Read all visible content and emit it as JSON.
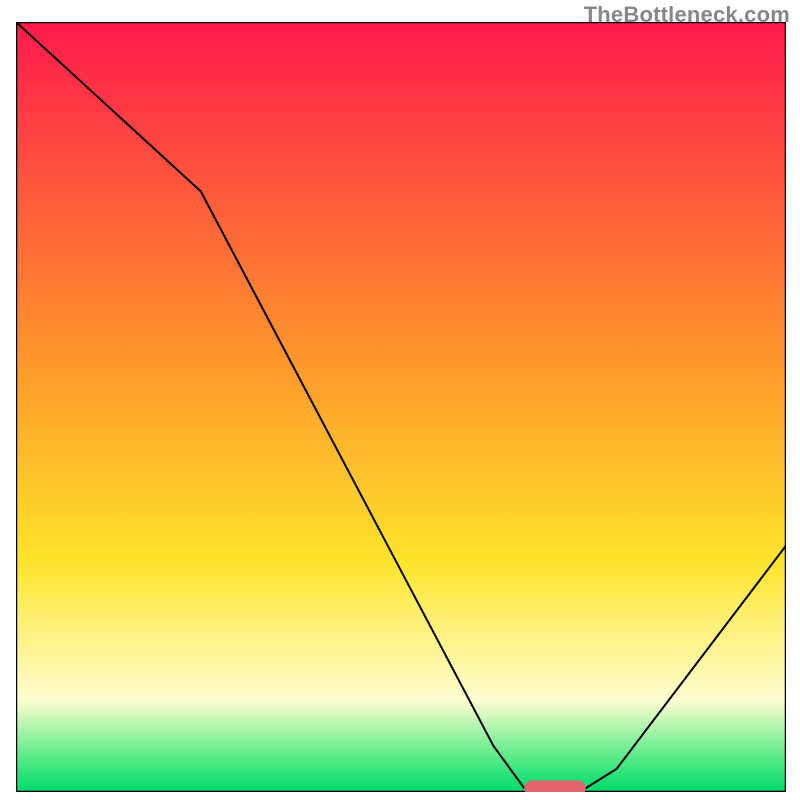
{
  "watermark": "TheBottleneck.com",
  "chart_data": {
    "type": "line",
    "title": "",
    "xlabel": "",
    "ylabel": "",
    "xlim": [
      0,
      100
    ],
    "ylim": [
      0,
      100
    ],
    "grid": false,
    "legend": false,
    "background": {
      "gradient_stops": [
        {
          "offset": 0.0,
          "color": "#ff1a4c"
        },
        {
          "offset": 0.45,
          "color": "#ff9a2b"
        },
        {
          "offset": 0.7,
          "color": "#ffe42b"
        },
        {
          "offset": 0.88,
          "color": "#fffed0"
        },
        {
          "offset": 0.96,
          "color": "#4eea84"
        },
        {
          "offset": 1.0,
          "color": "#00d86a"
        }
      ],
      "green_band": {
        "y_top": 96.5,
        "y_bottom": 100,
        "color": "#00d86a"
      }
    },
    "series": [
      {
        "name": "bottleneck-curve",
        "color": "#000000",
        "stroke_width": 2,
        "points": [
          {
            "x": 0,
            "y": 100.0
          },
          {
            "x": 24,
            "y": 78.0
          },
          {
            "x": 62,
            "y": 6.0
          },
          {
            "x": 66,
            "y": 0.5
          },
          {
            "x": 74,
            "y": 0.5
          },
          {
            "x": 78,
            "y": 3.0
          },
          {
            "x": 100,
            "y": 32.0
          }
        ]
      }
    ],
    "markers": [
      {
        "name": "optimal-marker",
        "shape": "pill",
        "color": "#e2656d",
        "x_center": 70.0,
        "y": 0.5,
        "width": 8.0,
        "height": 2.0
      }
    ]
  }
}
